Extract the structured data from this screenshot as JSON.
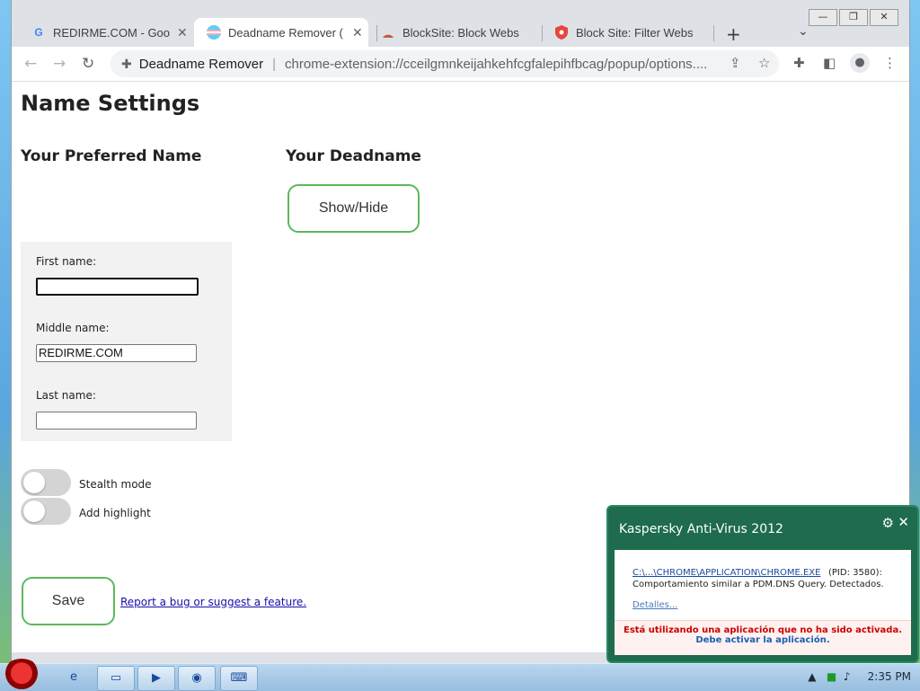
{
  "browser": {
    "tabs": [
      {
        "title": "REDIRME.COM - Goog",
        "favicon": "google-g-icon",
        "active": false
      },
      {
        "title": "Deadname Remover (",
        "favicon": "trans-flag-icon",
        "active": true
      },
      {
        "title": "BlockSite: Block Websi",
        "favicon": "blocksite-icon",
        "active": false
      },
      {
        "title": "Block Site: Filter Webs",
        "favicon": "shield-icon",
        "active": false
      }
    ],
    "window_controls": {
      "minimize": "—",
      "restore": "❐",
      "close": "✕"
    },
    "omnibox": {
      "site_name": "Deadname Remover",
      "url": "chrome-extension://cceilgmnkeijahkehfcgfalepihfbcag/popup/options...."
    }
  },
  "page": {
    "title": "Name Settings",
    "preferred_heading": "Your Preferred Name",
    "deadname_heading": "Your Deadname",
    "show_hide_label": "Show/Hide",
    "fields": {
      "first_label": "First name:",
      "first_value": "",
      "middle_label": "Middle name:",
      "middle_value": "REDIRME.COM",
      "last_label": "Last name:",
      "last_value": ""
    },
    "toggles": {
      "stealth_label": "Stealth mode",
      "stealth_on": false,
      "highlight_label": "Add highlight",
      "highlight_on": false
    },
    "save_label": "Save",
    "bug_link": "Report a bug or suggest a feature."
  },
  "kaspersky": {
    "title": "Kaspersky Anti-Virus 2012",
    "path": "C:\\...\\CHROME\\APPLICATION\\CHROME.EXE",
    "pid": "(PID: 3580):",
    "description": "Comportamiento similar a PDM.DNS Query. Detectados.",
    "details": "Detalles...",
    "warning": "Está utilizando una aplicación que no ha sido activada.",
    "activate": "Debe activar la aplicación."
  },
  "taskbar": {
    "clock": "2:35 PM"
  },
  "colors": {
    "accent_green": "#5cb85c",
    "kaspersky_green": "#1e6b4e",
    "link_blue": "#1a0dab"
  }
}
